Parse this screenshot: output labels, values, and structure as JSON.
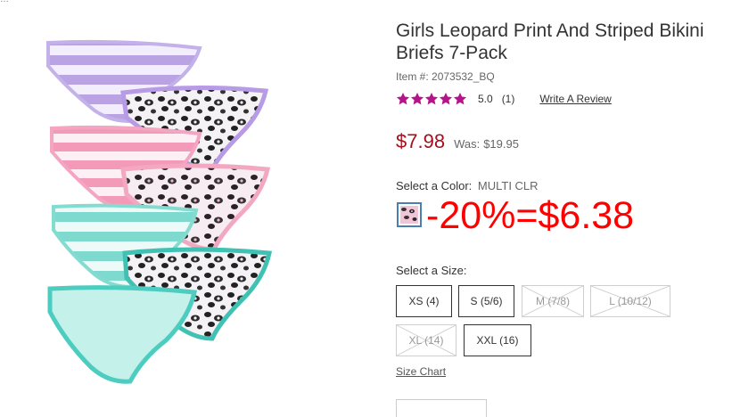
{
  "product": {
    "title": "Girls Leopard Print And Striped Bikini Briefs 7-Pack",
    "item_number": "Item #: 2073532_BQ",
    "rating_value": "5.0",
    "rating_count": "(1)",
    "review_link": "Write A Review",
    "price": "$7.98",
    "was_label": "Was:",
    "was_price": "$19.95"
  },
  "color": {
    "label": "Select a Color:",
    "value": "MULTI CLR",
    "promo_overlay": "-20%=$6.38"
  },
  "sizes": {
    "label": "Select a Size:",
    "options": [
      {
        "label": "XS (4)",
        "available": true
      },
      {
        "label": "S (5/6)",
        "available": true
      },
      {
        "label": "M (7/8)",
        "available": false
      },
      {
        "label": "L (10/12)",
        "available": false
      },
      {
        "label": "XL (14)",
        "available": false
      },
      {
        "label": "XXL (16)",
        "available": true
      }
    ],
    "size_chart": "Size Chart"
  },
  "colors": {
    "star": "#b5138c",
    "price": "#a50f1e",
    "promo": "#ff0000",
    "swatch_border": "#4a7fb0"
  }
}
